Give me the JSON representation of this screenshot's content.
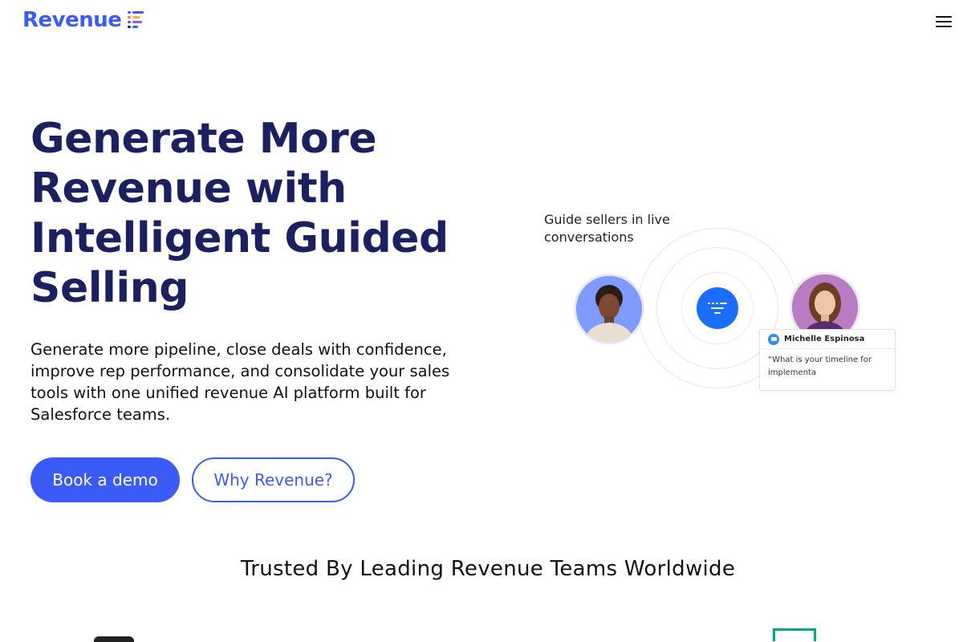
{
  "header": {
    "logo_text": "Revenue",
    "brand_color": "#3b5bf6",
    "menu_icon": "hamburger-icon"
  },
  "hero": {
    "title": "Generate More Revenue with Intelligent Guided Selling",
    "subtitle": "Generate more pipeline, close deals with confidence, improve rep performance, and consolidate your sales tools with one unified revenue AI platform built for Salesforce teams.",
    "primary_button": "Book a demo",
    "secondary_button": "Why Revenue?"
  },
  "illustration": {
    "caption": "Guide sellers in live conversations",
    "chat": {
      "name": "Michelle Espinosa",
      "message": "“What is your timeline for implementa"
    }
  },
  "trusted": {
    "heading": "Trusted By Leading Revenue Teams Worldwide"
  }
}
